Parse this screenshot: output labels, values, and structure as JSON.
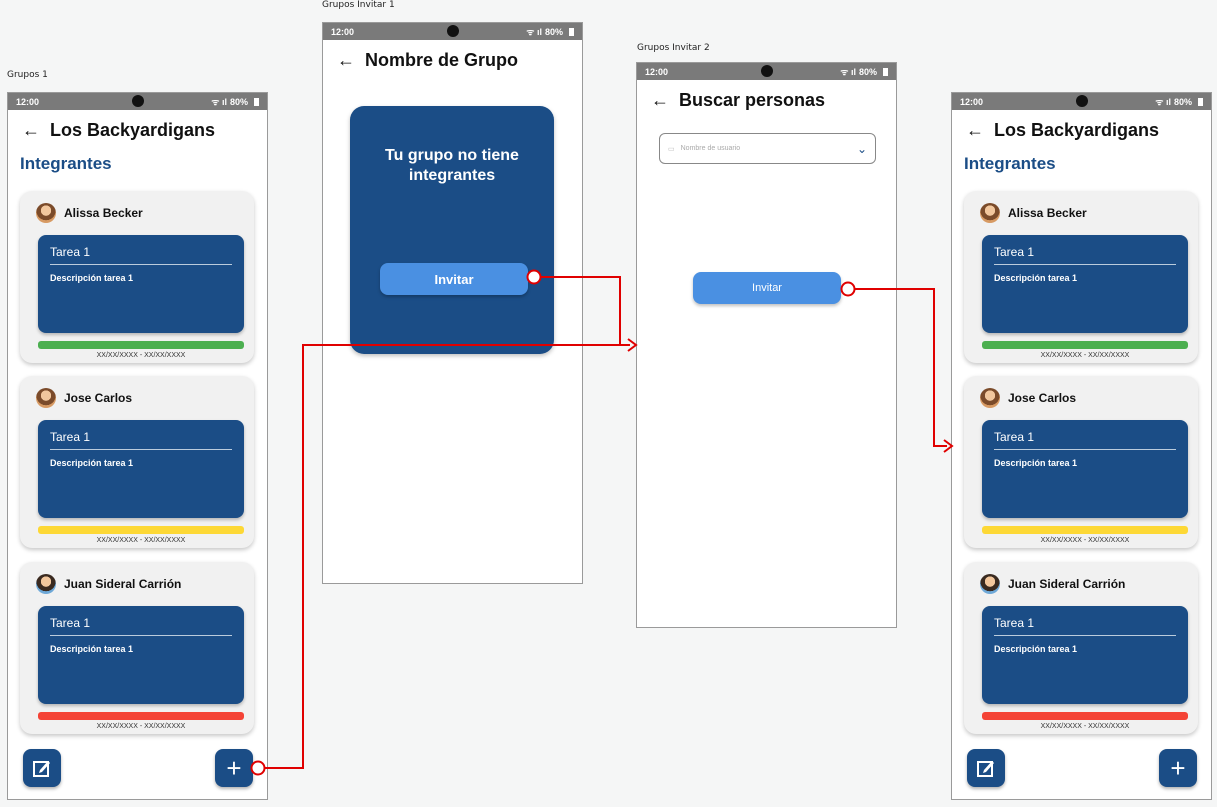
{
  "frames": {
    "grupos1": "Grupos 1",
    "invitar1": "Grupos Invitar 1",
    "invitar2": "Grupos Invitar 2"
  },
  "status": {
    "time": "12:00",
    "battery": "80%"
  },
  "group_screen": {
    "title": "Los Backyardigans",
    "section": "Integrantes",
    "members": [
      {
        "name": "Alissa Becker",
        "task_title": "Tarea 1",
        "task_desc": "Descripción tarea 1",
        "dates": "XX/XX/XXXX - XX/XX/XXXX",
        "status_color": "#4caf50"
      },
      {
        "name": "Jose Carlos",
        "task_title": "Tarea 1",
        "task_desc": "Descripción tarea 1",
        "dates": "XX/XX/XXXX - XX/XX/XXXX",
        "status_color": "#fdd835"
      },
      {
        "name": "Juan Sideral Carrión",
        "task_title": "Tarea 1",
        "task_desc": "Descripción tarea 1",
        "dates": "XX/XX/XXXX - XX/XX/XXXX",
        "status_color": "#f44336"
      }
    ]
  },
  "invitar1": {
    "title": "Nombre de Grupo",
    "empty_message": "Tu grupo no tiene integrantes",
    "invite_label": "Invitar"
  },
  "invitar2": {
    "title": "Buscar personas",
    "select_placeholder": "Nombre de usuario",
    "invite_label": "Invitar"
  },
  "colors": {
    "primary": "#1b4d86",
    "accent": "#4a90e2",
    "connector": "#e00000"
  },
  "icons": {
    "back": "arrow-left-icon",
    "edit": "edit-icon",
    "add": "plus-icon",
    "dropdown": "chevron-down-icon"
  }
}
